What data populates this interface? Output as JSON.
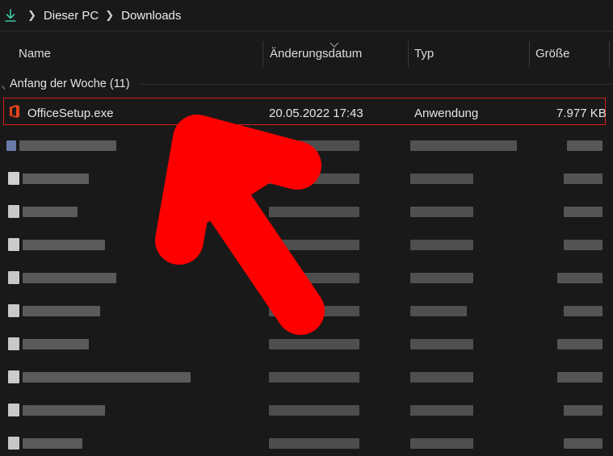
{
  "breadcrumb": {
    "icon": "download-arrow-icon",
    "items": [
      "Dieser PC",
      "Downloads"
    ]
  },
  "columns": {
    "name": "Name",
    "date": "Änderungsdatum",
    "type": "Typ",
    "size": "Größe"
  },
  "group": {
    "label": "Anfang der Woche (11)"
  },
  "selected_file": {
    "name": "OfficeSetup.exe",
    "date": "20.05.2022 17:43",
    "type": "Anwendung",
    "size": "7.977 KB",
    "icon": "office-icon"
  },
  "colors": {
    "background": "#191919",
    "accent_download": "#3ec3a7",
    "selection_border": "#d61f1f",
    "arrow": "#ff0000",
    "office": "#e3431d"
  },
  "annotation": {
    "type": "red-arrow"
  }
}
